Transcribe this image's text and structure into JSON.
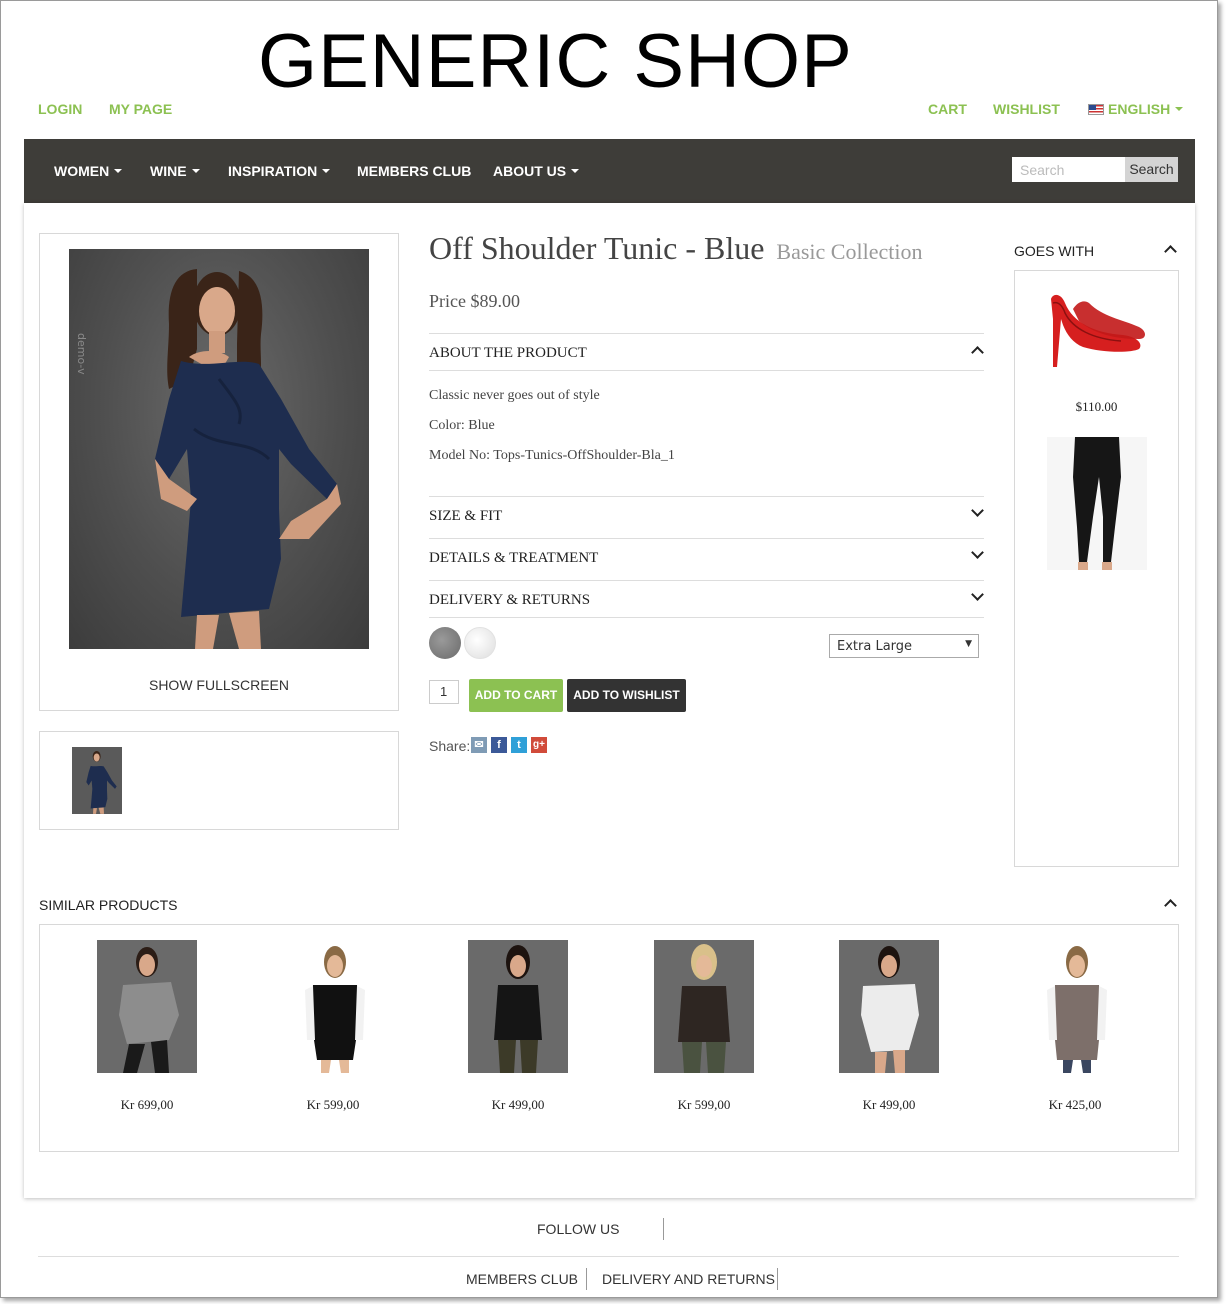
{
  "shop": {
    "logo": "GENERIC SHOP"
  },
  "top_links": {
    "login": "LOGIN",
    "my_page": "MY PAGE",
    "cart": "CART",
    "wishlist": "WISHLIST",
    "language": "ENGLISH"
  },
  "nav": {
    "items": [
      {
        "label": "WOMEN",
        "dropdown": true
      },
      {
        "label": "WINE",
        "dropdown": true
      },
      {
        "label": "INSPIRATION",
        "dropdown": true
      },
      {
        "label": "MEMBERS CLUB",
        "dropdown": false
      },
      {
        "label": "ABOUT US",
        "dropdown": true
      }
    ],
    "search_placeholder": "Search",
    "search_button": "Search"
  },
  "product": {
    "title": "Off Shoulder Tunic - Blue",
    "collection": "Basic Collection",
    "price": "Price $89.00",
    "show_fullscreen": "SHOW FULLSCREEN",
    "image_watermark": "demo-v",
    "about_label": "ABOUT THE PRODUCT",
    "description": [
      "Classic never goes out of style",
      "Color: Blue",
      "Model No: Tops-Tunics-OffShoulder-Bla_1"
    ],
    "sections": [
      "SIZE & FIT",
      "DETAILS & TREATMENT",
      "DELIVERY & RETURNS"
    ],
    "swatch_colors": [
      "#7b7b7b",
      "#eeeeee"
    ],
    "size_selected": "Extra Large",
    "quantity": "1",
    "add_to_cart": "ADD TO CART",
    "add_to_wishlist": "ADD TO WISHLIST",
    "share_label": "Share:"
  },
  "goes_with": {
    "title": "GOES WITH",
    "items": [
      {
        "name": "red-pumps",
        "price": "$110.00"
      },
      {
        "name": "black-leggings",
        "price": ""
      }
    ]
  },
  "similar": {
    "title": "SIMILAR PRODUCTS",
    "items": [
      {
        "price": "Kr 699,00"
      },
      {
        "price": "Kr 599,00"
      },
      {
        "price": "Kr 499,00"
      },
      {
        "price": "Kr 599,00"
      },
      {
        "price": "Kr 499,00"
      },
      {
        "price": "Kr 425,00"
      }
    ]
  },
  "footer": {
    "follow_us": "FOLLOW US",
    "members_club": "MEMBERS CLUB",
    "delivery_returns": "DELIVERY AND RETURNS"
  },
  "colors": {
    "accent_green": "#8cc152",
    "nav_bg": "#3e3d39",
    "wishlist_btn": "#333333"
  }
}
